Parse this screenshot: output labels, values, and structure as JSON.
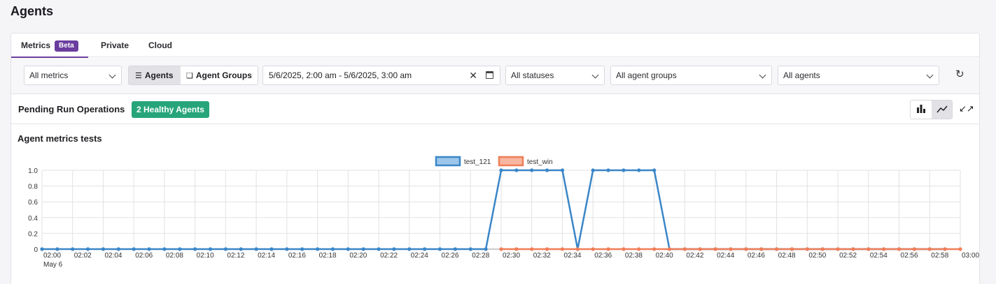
{
  "page": {
    "title": "Agents"
  },
  "tabs": [
    {
      "label": "Metrics",
      "badge": "Beta"
    },
    {
      "label": "Private"
    },
    {
      "label": "Cloud"
    }
  ],
  "toolbar": {
    "metrics_select": "All metrics",
    "seg_agents": "Agents",
    "seg_groups": "Agent Groups",
    "date_range": "5/6/2025, 2:00 am - 5/6/2025, 3:00 am",
    "status_select": "All statuses",
    "groups_select": "All agent groups",
    "agents_select": "All agents"
  },
  "section": {
    "title": "Pending Run Operations",
    "badge": "2 Healthy Agents"
  },
  "colors": {
    "accent": "#6b3fa0",
    "healthy": "#27a57a",
    "series1": "#3a86c8",
    "series2": "#f07d58"
  },
  "chart_data": {
    "type": "line",
    "title": "Agent metrics tests",
    "legend_position": "top",
    "ylim": [
      0,
      1.0
    ],
    "y_ticks": [
      "0",
      "0.2",
      "0.4",
      "0.6",
      "0.8",
      "1.0"
    ],
    "x_ticks": [
      "02:00",
      "02:02",
      "02:04",
      "02:06",
      "02:08",
      "02:10",
      "02:12",
      "02:14",
      "02:16",
      "02:18",
      "02:20",
      "02:22",
      "02:24",
      "02:26",
      "02:28",
      "02:30",
      "02:32",
      "02:34",
      "02:36",
      "02:38",
      "02:40",
      "02:42",
      "02:44",
      "02:46",
      "02:48",
      "02:50",
      "02:52",
      "02:54",
      "02:56",
      "02:58",
      "03:00"
    ],
    "x_subtitle": "May 6",
    "x_minutes": [
      0,
      1,
      2,
      3,
      4,
      5,
      6,
      7,
      8,
      9,
      10,
      11,
      12,
      13,
      14,
      15,
      16,
      17,
      18,
      19,
      20,
      21,
      22,
      23,
      24,
      25,
      26,
      27,
      28,
      29,
      30,
      31,
      32,
      33,
      34,
      35,
      36,
      37,
      38,
      39,
      40,
      41,
      42,
      43,
      44,
      45,
      46,
      47,
      48,
      49,
      50,
      51,
      52,
      53,
      54,
      55,
      56,
      57,
      58,
      59,
      60
    ],
    "series": [
      {
        "name": "test_121",
        "color": "#3a86c8",
        "fill": "#9cc6ea",
        "values": [
          0,
          0,
          0,
          0,
          0,
          0,
          0,
          0,
          0,
          0,
          0,
          0,
          0,
          0,
          0,
          0,
          0,
          0,
          0,
          0,
          0,
          0,
          0,
          0,
          0,
          0,
          0,
          0,
          0,
          0,
          1,
          1,
          1,
          1,
          1,
          0,
          1,
          1,
          1,
          1,
          1,
          0,
          0,
          0,
          0,
          0,
          0,
          0,
          0,
          0,
          0,
          0,
          0,
          0,
          0,
          0,
          0,
          0,
          0,
          0,
          null
        ]
      },
      {
        "name": "test_win",
        "color": "#f07d58",
        "fill": "#f7b6a0",
        "values": [
          null,
          null,
          null,
          null,
          null,
          null,
          null,
          null,
          null,
          null,
          null,
          null,
          null,
          null,
          null,
          null,
          null,
          null,
          null,
          null,
          null,
          null,
          null,
          null,
          null,
          null,
          null,
          null,
          null,
          null,
          0,
          0,
          0,
          0,
          0,
          0,
          0,
          0,
          0,
          0,
          0,
          0,
          0,
          0,
          0,
          0,
          0,
          0,
          0,
          0,
          0,
          0,
          0,
          0,
          0,
          0,
          0,
          0,
          0,
          0,
          0
        ]
      }
    ]
  }
}
